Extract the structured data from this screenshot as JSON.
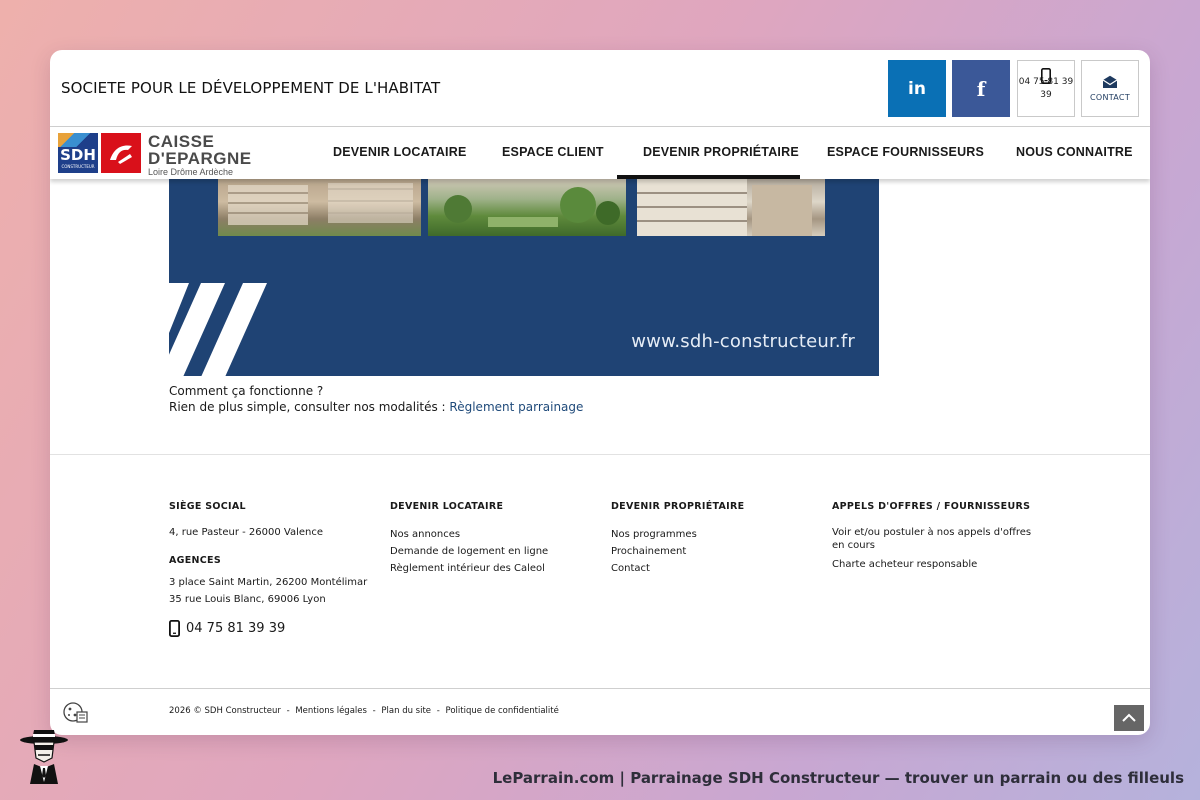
{
  "header": {
    "site_title": "SOCIETE POUR LE DÉVELOPPEMENT DE L'HABITAT",
    "linkedin_label": "in",
    "facebook_label": "f",
    "phone_line1": "04 75 81 39",
    "phone_line2": "39",
    "contact_label": "CONTACT"
  },
  "logo": {
    "sdh": "SDH",
    "sdh_small": "CONSTRUCTEUR",
    "line1": "CAISSE",
    "line2": "D'EPARGNE",
    "line3": "Loire Drôme Ardèche"
  },
  "nav": {
    "items": [
      {
        "label": "DEVENIR LOCATAIRE"
      },
      {
        "label": "ESPACE CLIENT"
      },
      {
        "label": "DEVENIR PROPRIÉTAIRE"
      },
      {
        "label": "ESPACE FOURNISSEURS"
      },
      {
        "label": "NOUS CONNAITRE"
      }
    ],
    "active_index": 2
  },
  "banner": {
    "url": "www.sdh-constructeur.fr"
  },
  "content": {
    "question": "Comment ça fonctionne ?",
    "answer_prefix": "Rien de plus simple, consulter nos modalités : ",
    "answer_link": "Règlement parrainage"
  },
  "footer": {
    "col1": {
      "heading": "SIÈGE SOCIAL",
      "address": "4, rue Pasteur - 26000 Valence",
      "agencies_heading": "AGENCES",
      "agency1": "3 place Saint Martin, 26200 Montélimar",
      "agency2": "35 rue Louis Blanc, 69006 Lyon",
      "phone": "04 75 81 39 39"
    },
    "col2": {
      "heading": "DEVENIR LOCATAIRE",
      "links": [
        "Nos annonces",
        "Demande de logement en ligne",
        "Règlement intérieur des Caleol"
      ]
    },
    "col3": {
      "heading": "DEVENIR PROPRIÉTAIRE",
      "links": [
        "Nos programmes",
        "Prochainement",
        "Contact"
      ]
    },
    "col4": {
      "heading": "APPELS D'OFFRES / FOURNISSEURS",
      "link1_line1": "Voir et/ou postuler à nos appels d'offres",
      "link1_line2": "en cours",
      "link2": "Charte acheteur responsable"
    },
    "bottom": {
      "copyright": "2026 © SDH Constructeur",
      "sep": "-",
      "mentions": "Mentions légales",
      "plan": "Plan du site",
      "privacy": "Politique de confidentialité"
    }
  },
  "caption": "LeParrain.com | Parrainage SDH Constructeur — trouver un parrain ou des filleuls",
  "colors": {
    "linkedin": "#0a70b5",
    "facebook": "#3b5898",
    "banner": "#1f4374",
    "link": "#1f4a7a"
  }
}
